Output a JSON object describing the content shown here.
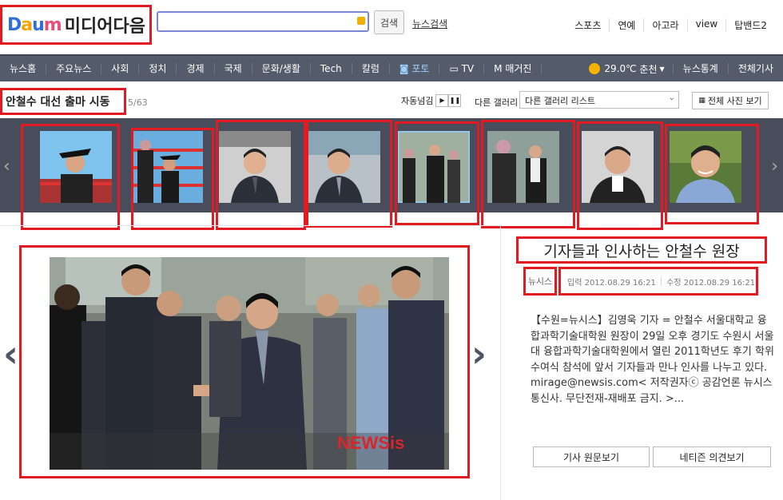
{
  "header": {
    "logo_text": "Daum",
    "site_title": "미디어다음",
    "search_button": "검색",
    "news_search_link": "뉴스검색",
    "top_nav": [
      "스포츠",
      "연예",
      "아고라",
      "view",
      "탑밴드2"
    ]
  },
  "gnb": {
    "items": [
      "뉴스홈",
      "주요뉴스",
      "사회",
      "정치",
      "경제",
      "국제",
      "문화/생활",
      "Tech",
      "칼럼",
      "포토",
      "TV",
      "매거진"
    ],
    "weather_temp": "29.0℃",
    "weather_city": "춘천",
    "news_stats": "뉴스통계",
    "all_articles": "전체기사"
  },
  "gallery": {
    "title": "안철수 대선 출마 시동",
    "count": "5/63",
    "autoplay_label": "자동넘김",
    "other_gallery_label": "다른 갤러리",
    "other_gallery_select": "다른 갤러리 리스트",
    "all_photos_button": "전체 사진 보기"
  },
  "article": {
    "title": "기자들과 인사하는 안철수 원장",
    "source": "뉴시스",
    "input_date": "입력 2012.08.29 16:21",
    "edit_date": "수정 2012.08.29 16:21",
    "body": "【수원=뉴시스】김영욱 기자 = 안철수 서울대학교 융합과학기술대학원 원장이 29일 오후 경기도 수원시 서울대 융합과학기술대학원에서 열린 2011학년도 후기 학위수여식 참석에 앞서 기자들과 만나 인사를 나누고 있다.mirage@newsis.com< 저작권자ⓒ 공감언론 뉴시스통신사. 무단전재-재배포 금지. >...",
    "btn_original": "기사 원문보기",
    "btn_netizen": "네티즌 의견보기"
  },
  "photo_watermark": "NEWSis",
  "colors": {
    "highlight_box": "#e21a22",
    "gnb_bg": "#545b6a",
    "strip_bg": "#474d5b"
  }
}
